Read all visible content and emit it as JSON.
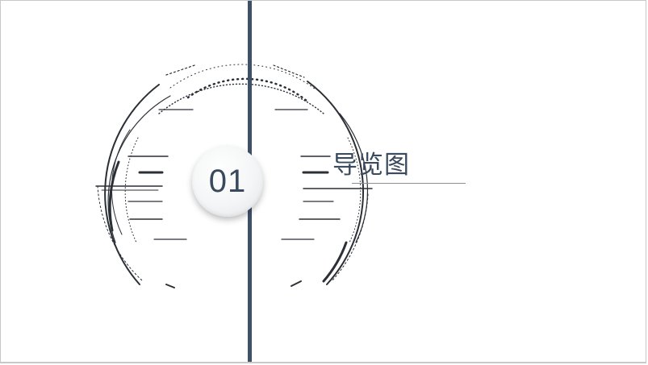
{
  "slide": {
    "section_number": "01",
    "title": "导览图"
  },
  "colors": {
    "accent": "#3f5168",
    "text": "#3a4a5e",
    "hud_lines": "#2b2f36"
  }
}
